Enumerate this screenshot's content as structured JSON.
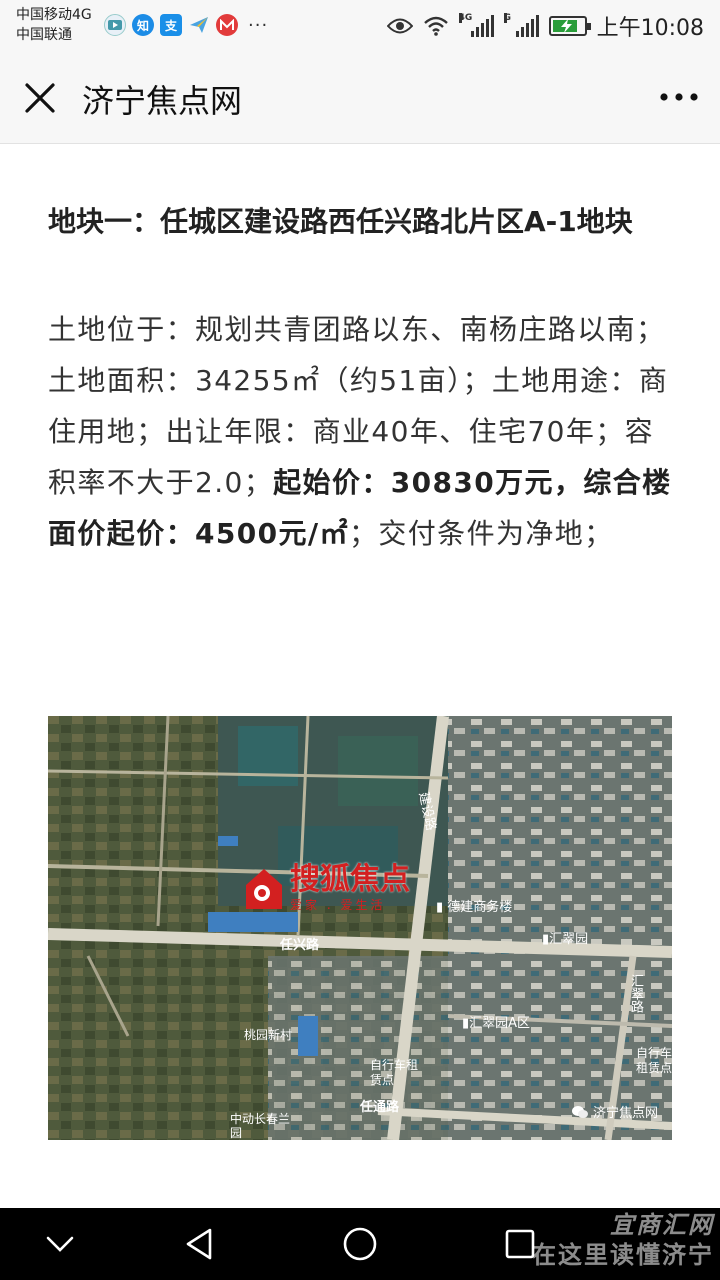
{
  "status_bar": {
    "carrier_1": "中国移动4G",
    "carrier_2": "中国联通",
    "app_icons": [
      "video-app-icon",
      "zhihu-icon",
      "alipay-icon",
      "paper-plane-icon",
      "metro-icon"
    ],
    "zhihu_glyph": "知",
    "alipay_glyph": "支",
    "overflow": "···",
    "network_tag_1": "4G",
    "network_tag_2": "G",
    "time": "上午10:08"
  },
  "title_bar": {
    "title": "济宁焦点网"
  },
  "article": {
    "headline": "地块一：任城区建设路西任兴路北片区A-1地块",
    "body_plain_1": "土地位于：规划共青团路以东、南杨庄路以南；土地面积：34255㎡（约51亩）；土地用途：商住用地；出让年限：商业40年、住宅70年；容积率不大于2.0；",
    "body_bold_1": "起始价：30830万元，综合楼面价起价：4500元/㎡",
    "body_plain_2": "；交付条件为净地；"
  },
  "map": {
    "logo_text": "搜狐焦点",
    "logo_slogan": "爱家 . 爱生活",
    "labels": {
      "jianshe_road": "建设路",
      "dejian_building": "德建商务楼",
      "huicuiyuan": "汇翠园",
      "renxing_road": "任兴路",
      "huicui_road": "汇翠路",
      "huicuiyuan_a": "汇翠园A区",
      "taoyuan_village": "桃园新村",
      "bike_rental_1": "自行车租赁点",
      "bike_rental_2": "自行车租赁点",
      "renyi_road": "任通路",
      "zhongdong_changchun": "中动长春兰园"
    },
    "watermark": "济宁焦点网"
  },
  "nav_bar": {
    "watermark_line_1": "宜商汇网",
    "watermark_line_2": "在这里读懂济宁"
  }
}
